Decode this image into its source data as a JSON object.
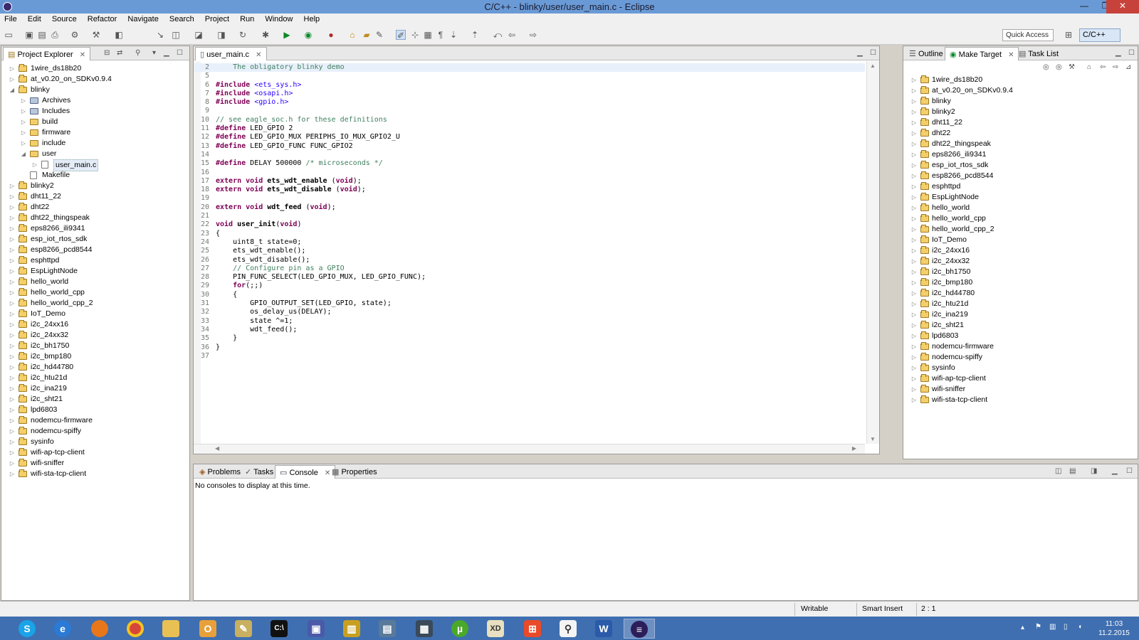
{
  "window": {
    "title": "C/C++ - blinky/user/user_main.c - Eclipse",
    "minimize": "—",
    "restore": "❐",
    "close": "✕"
  },
  "menu": [
    "File",
    "Edit",
    "Source",
    "Refactor",
    "Navigate",
    "Search",
    "Project",
    "Run",
    "Window",
    "Help"
  ],
  "toolbar": {
    "quick_access": "Quick Access",
    "perspective": "C/C++"
  },
  "project_explorer": {
    "tab": "Project Explorer",
    "items": [
      {
        "label": "1wire_ds18b20",
        "depth": 0,
        "kind": "project",
        "open": false
      },
      {
        "label": "at_v0.20_on_SDKv0.9.4",
        "depth": 0,
        "kind": "project",
        "open": false
      },
      {
        "label": "blinky",
        "depth": 0,
        "kind": "project",
        "open": true
      },
      {
        "label": "Archives",
        "depth": 1,
        "kind": "lib",
        "open": false
      },
      {
        "label": "Includes",
        "depth": 1,
        "kind": "lib",
        "open": false
      },
      {
        "label": "build",
        "depth": 1,
        "kind": "folder",
        "open": false
      },
      {
        "label": "firmware",
        "depth": 1,
        "kind": "folder",
        "open": false
      },
      {
        "label": "include",
        "depth": 1,
        "kind": "folder",
        "open": false
      },
      {
        "label": "user",
        "depth": 1,
        "kind": "folder",
        "open": true
      },
      {
        "label": "user_main.c",
        "depth": 2,
        "kind": "file",
        "open": false,
        "selected": true
      },
      {
        "label": "Makefile",
        "depth": 1,
        "kind": "file",
        "leaf": true
      },
      {
        "label": "blinky2",
        "depth": 0,
        "kind": "project",
        "open": false
      },
      {
        "label": "dht11_22",
        "depth": 0,
        "kind": "project",
        "open": false
      },
      {
        "label": "dht22",
        "depth": 0,
        "kind": "project",
        "open": false
      },
      {
        "label": "dht22_thingspeak",
        "depth": 0,
        "kind": "project",
        "open": false
      },
      {
        "label": "eps8266_ili9341",
        "depth": 0,
        "kind": "project",
        "open": false
      },
      {
        "label": "esp_iot_rtos_sdk",
        "depth": 0,
        "kind": "project",
        "open": false
      },
      {
        "label": "esp8266_pcd8544",
        "depth": 0,
        "kind": "project",
        "open": false
      },
      {
        "label": "esphttpd",
        "depth": 0,
        "kind": "project",
        "open": false
      },
      {
        "label": "EspLightNode",
        "depth": 0,
        "kind": "project",
        "open": false
      },
      {
        "label": "hello_world",
        "depth": 0,
        "kind": "project",
        "open": false
      },
      {
        "label": "hello_world_cpp",
        "depth": 0,
        "kind": "project",
        "open": false
      },
      {
        "label": "hello_world_cpp_2",
        "depth": 0,
        "kind": "project",
        "open": false
      },
      {
        "label": "IoT_Demo",
        "depth": 0,
        "kind": "project",
        "open": false
      },
      {
        "label": "i2c_24xx16",
        "depth": 0,
        "kind": "project",
        "open": false
      },
      {
        "label": "i2c_24xx32",
        "depth": 0,
        "kind": "project",
        "open": false
      },
      {
        "label": "i2c_bh1750",
        "depth": 0,
        "kind": "project",
        "open": false
      },
      {
        "label": "i2c_bmp180",
        "depth": 0,
        "kind": "project",
        "open": false
      },
      {
        "label": "i2c_hd44780",
        "depth": 0,
        "kind": "project",
        "open": false
      },
      {
        "label": "i2c_htu21d",
        "depth": 0,
        "kind": "project",
        "open": false
      },
      {
        "label": "i2c_ina219",
        "depth": 0,
        "kind": "project",
        "open": false
      },
      {
        "label": "i2c_sht21",
        "depth": 0,
        "kind": "project",
        "open": false
      },
      {
        "label": "lpd6803",
        "depth": 0,
        "kind": "project",
        "open": false
      },
      {
        "label": "nodemcu-firmware",
        "depth": 0,
        "kind": "project",
        "open": false
      },
      {
        "label": "nodemcu-spiffy",
        "depth": 0,
        "kind": "project",
        "open": false
      },
      {
        "label": "sysinfo",
        "depth": 0,
        "kind": "project",
        "open": false
      },
      {
        "label": "wifi-ap-tcp-client",
        "depth": 0,
        "kind": "project",
        "open": false
      },
      {
        "label": "wifi-sniffer",
        "depth": 0,
        "kind": "project",
        "open": false
      },
      {
        "label": "wifi-sta-tcp-client",
        "depth": 0,
        "kind": "project",
        "open": false
      }
    ]
  },
  "editor": {
    "tab": "user_main.c",
    "lines": [
      {
        "n": "2",
        "text": "    The obligatory blinky demo",
        "type": "comment",
        "hl": true
      },
      {
        "n": "5",
        "text": "",
        "type": "plain"
      },
      {
        "n": "6",
        "text": "#include <ets_sys.h>",
        "type": "include"
      },
      {
        "n": "7",
        "text": "#include <osapi.h>",
        "type": "include"
      },
      {
        "n": "8",
        "text": "#include <gpio.h>",
        "type": "include"
      },
      {
        "n": "9",
        "text": "",
        "type": "plain"
      },
      {
        "n": "10",
        "text": "// see eagle_soc.h for these definitions",
        "type": "comment"
      },
      {
        "n": "11",
        "text": "#define LED_GPIO 2",
        "type": "define"
      },
      {
        "n": "12",
        "text": "#define LED_GPIO_MUX PERIPHS_IO_MUX_GPIO2_U",
        "type": "define"
      },
      {
        "n": "13",
        "text": "#define LED_GPIO_FUNC FUNC_GPIO2",
        "type": "define"
      },
      {
        "n": "14",
        "text": "",
        "type": "plain"
      },
      {
        "n": "15",
        "text": "#define DELAY 500000 /* microseconds */",
        "type": "define_comment"
      },
      {
        "n": "16",
        "text": "",
        "type": "plain"
      },
      {
        "n": "17",
        "text": "extern void ets_wdt_enable (void);",
        "type": "extern"
      },
      {
        "n": "18",
        "text": "extern void ets_wdt_disable (void);",
        "type": "extern"
      },
      {
        "n": "19",
        "text": "",
        "type": "plain"
      },
      {
        "n": "20",
        "text": "extern void wdt_feed (void);",
        "type": "extern"
      },
      {
        "n": "21",
        "text": "",
        "type": "plain"
      },
      {
        "n": "22",
        "text": "void user_init(void)",
        "type": "func"
      },
      {
        "n": "23",
        "text": "{",
        "type": "plain"
      },
      {
        "n": "24",
        "text": "    uint8_t state=0;",
        "type": "plain"
      },
      {
        "n": "25",
        "text": "    ets_wdt_enable();",
        "type": "plain"
      },
      {
        "n": "26",
        "text": "    ets_wdt_disable();",
        "type": "plain"
      },
      {
        "n": "27",
        "text": "    // Configure pin as a GPIO",
        "type": "comment"
      },
      {
        "n": "28",
        "text": "    PIN_FUNC_SELECT(LED_GPIO_MUX, LED_GPIO_FUNC);",
        "type": "plain"
      },
      {
        "n": "29",
        "text": "    for(;;)",
        "type": "for"
      },
      {
        "n": "30",
        "text": "    {",
        "type": "plain"
      },
      {
        "n": "31",
        "text": "        GPIO_OUTPUT_SET(LED_GPIO, state);",
        "type": "plain"
      },
      {
        "n": "32",
        "text": "        os_delay_us(DELAY);",
        "type": "plain"
      },
      {
        "n": "33",
        "text": "        state ^=1;",
        "type": "plain"
      },
      {
        "n": "34",
        "text": "        wdt_feed();",
        "type": "plain"
      },
      {
        "n": "35",
        "text": "    }",
        "type": "plain"
      },
      {
        "n": "36",
        "text": "}",
        "type": "plain"
      },
      {
        "n": "37",
        "text": "",
        "type": "plain"
      }
    ]
  },
  "right_panel": {
    "tabs": [
      "Outline",
      "Make Target",
      "Task List"
    ],
    "items": [
      "1wire_ds18b20",
      "at_v0.20_on_SDKv0.9.4",
      "blinky",
      "blinky2",
      "dht11_22",
      "dht22",
      "dht22_thingspeak",
      "eps8266_ili9341",
      "esp_iot_rtos_sdk",
      "esp8266_pcd8544",
      "esphttpd",
      "EspLightNode",
      "hello_world",
      "hello_world_cpp",
      "hello_world_cpp_2",
      "IoT_Demo",
      "i2c_24xx16",
      "i2c_24xx32",
      "i2c_bh1750",
      "i2c_bmp180",
      "i2c_hd44780",
      "i2c_htu21d",
      "i2c_ina219",
      "i2c_sht21",
      "lpd6803",
      "nodemcu-firmware",
      "nodemcu-spiffy",
      "sysinfo",
      "wifi-ap-tcp-client",
      "wifi-sniffer",
      "wifi-sta-tcp-client"
    ]
  },
  "bottom_panel": {
    "tabs": [
      "Problems",
      "Tasks",
      "Console",
      "Properties"
    ],
    "message": "No consoles to display at this time."
  },
  "status": {
    "writable": "Writable",
    "insert_mode": "Smart Insert",
    "position": "2 : 1"
  },
  "clock": {
    "time": "11:03",
    "date": "11.2.2015"
  },
  "colors": {
    "keyword": "#7f0055",
    "comment": "#3f7f5f",
    "include_string": "#2a00ff"
  }
}
